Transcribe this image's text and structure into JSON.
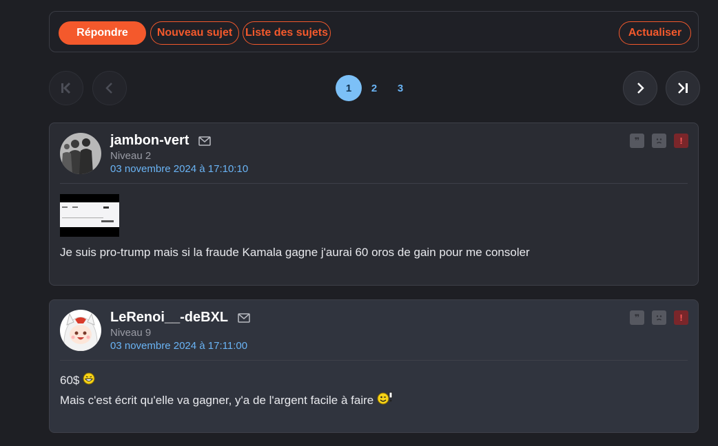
{
  "toolbar": {
    "reply": "Répondre",
    "new_topic": "Nouveau sujet",
    "topic_list": "Liste des sujets",
    "refresh": "Actualiser"
  },
  "pagination": {
    "pages": [
      "1",
      "2",
      "3"
    ],
    "current": "1"
  },
  "posts": [
    {
      "username": "jambon-vert",
      "level": "Niveau 2",
      "date": "03 novembre 2024 à 17:10:10",
      "text": "Je suis pro-trump mais si la fraude Kamala gagne j'aurai 60 oros de gain pour me consoler"
    },
    {
      "username": "LeRenoi__-deBXL",
      "level": "Niveau 9",
      "date": "03 novembre 2024 à 17:11:00",
      "line1": "60$",
      "line2": "Mais c'est écrit qu'elle va gagner, y'a de l'argent facile à faire"
    }
  ],
  "colors": {
    "accent": "#f4592c",
    "link": "#6ab4f5",
    "background": "#1e1f24"
  }
}
